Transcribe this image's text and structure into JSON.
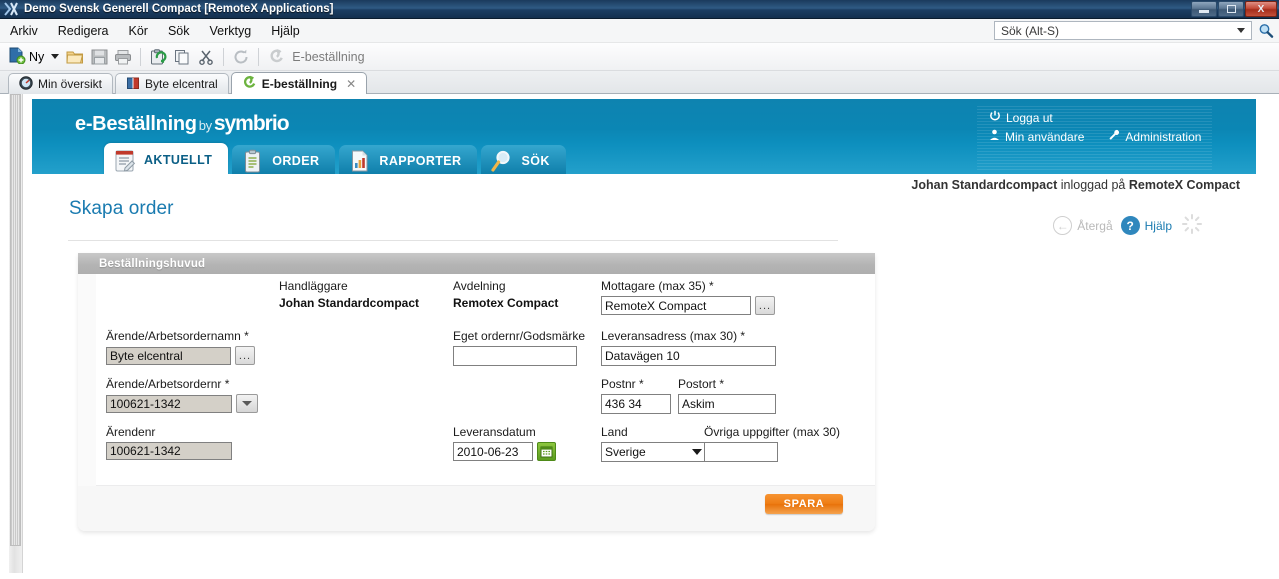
{
  "window": {
    "title": "Demo Svensk Generell Compact [RemoteX Applications]",
    "app_icon": "remotex-app-icon",
    "minimize_label": "",
    "restore_label": "",
    "close_label": "X"
  },
  "menubar": {
    "items": [
      {
        "label": "Arkiv"
      },
      {
        "label": "Redigera"
      },
      {
        "label": "Kör"
      },
      {
        "label": "Sök"
      },
      {
        "label": "Verktyg"
      },
      {
        "label": "Hjälp"
      }
    ]
  },
  "search": {
    "value": "Sök  (Alt-S)",
    "placeholder": "Sök  (Alt-S)",
    "icon": "magnifier-icon"
  },
  "toolbar": {
    "new_label": "Ny",
    "icons": [
      {
        "name": "new-icon"
      },
      {
        "name": "open-folder-icon"
      },
      {
        "name": "save-icon"
      },
      {
        "name": "print-icon"
      },
      {
        "name": "paste-icon"
      },
      {
        "name": "copy-icon"
      },
      {
        "name": "cut-icon"
      },
      {
        "name": "refresh-icon"
      }
    ],
    "module_label": "E-beställning",
    "module_icon": "ebestallning-icon"
  },
  "doctabs": [
    {
      "label": "Min översikt",
      "icon": "dashboard-icon",
      "active": false,
      "closable": false
    },
    {
      "label": "Byte elcentral",
      "icon": "book-icon",
      "active": false,
      "closable": false
    },
    {
      "label": "E-beställning",
      "icon": "swirl-icon",
      "active": true,
      "closable": true,
      "close_label": "✕"
    }
  ],
  "appheader": {
    "logo_main": "e-Beställning",
    "logo_by": "by",
    "logo_brand": "symbrio",
    "user_links": [
      {
        "label": "Logga ut",
        "icon": "power-icon"
      },
      {
        "label": "Min användare",
        "icon": "user-icon"
      },
      {
        "label": "Administration",
        "icon": "wrench-icon"
      }
    ],
    "nav_tabs": [
      {
        "label": "AKTUELLT",
        "icon": "calendar-note-icon",
        "active": true
      },
      {
        "label": "ORDER",
        "icon": "clipboard-icon",
        "active": false
      },
      {
        "label": "RAPPORTER",
        "icon": "report-chart-icon",
        "active": false
      },
      {
        "label": "SÖK",
        "icon": "magnifier-icon",
        "active": false
      }
    ]
  },
  "appbody": {
    "login_user": "Johan Standardcompact",
    "login_mid": " inloggad på ",
    "login_system": "RemoteX Compact",
    "page_title": "Skapa order",
    "back_label": "Återgå",
    "back_icon": "back-arrow-icon",
    "help_label": "Hjälp",
    "help_icon": "question-mark-icon",
    "spinner_icon": "loading-spinner-icon"
  },
  "panel": {
    "header": "Beställningshuvud",
    "save_label": "SPARA",
    "fields": {
      "handlaggare": {
        "label": "Handläggare",
        "value": "Johan Standardcompact"
      },
      "avdelning": {
        "label": "Avdelning",
        "value": "Remotex Compact"
      },
      "mottagare": {
        "label": "Mottagare (max 35) *",
        "value": "RemoteX Compact",
        "browse": "..."
      },
      "arende_namn": {
        "label": "Ärende/Arbetsordernamn *",
        "value": "Byte elcentral",
        "browse": "..."
      },
      "eget_ordernr": {
        "label": "Eget ordernr/Godsmärke",
        "value": ""
      },
      "leveransadress": {
        "label": "Leveransadress (max 30)  *",
        "value": "Datavägen 10"
      },
      "arende_nr": {
        "label": "Ärende/Arbetsordernr *",
        "value": "100621-1342"
      },
      "postnr": {
        "label": "Postnr  *",
        "value": "436 34"
      },
      "postort": {
        "label": "Postort  *",
        "value": "Askim"
      },
      "arendenr": {
        "label": "Ärendenr",
        "value": "100621-1342"
      },
      "leveransdatum": {
        "label": "Leveransdatum",
        "value": "2010-06-23",
        "calendar_icon": "calendar-icon"
      },
      "land": {
        "label": "Land",
        "value": "Sverige"
      },
      "ovriga": {
        "label": "Övriga uppgifter (max 30)",
        "value": ""
      }
    }
  },
  "colors": {
    "brand_teal": "#0d86b4",
    "accent_orange": "#ee7d14",
    "title_blue": "#1a7bb0",
    "panel_grey": "#b4b4b4"
  }
}
